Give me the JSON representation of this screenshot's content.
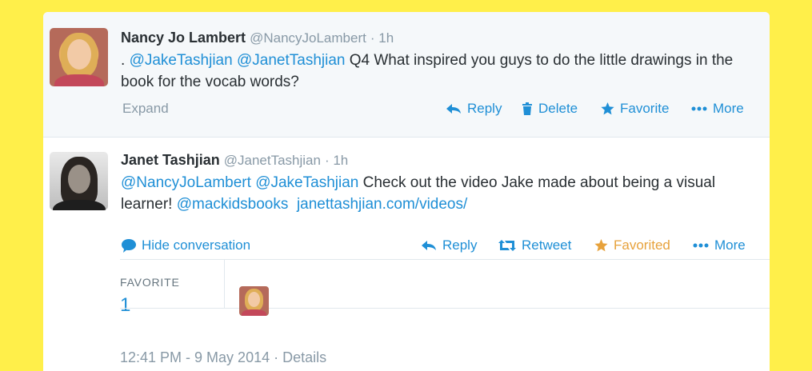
{
  "colors": {
    "background": "#ffef4a",
    "link": "#1f8fd6",
    "muted": "#8899a6",
    "favorited": "#e7a23c"
  },
  "tweet1": {
    "fullname": "Nancy Jo Lambert",
    "screenname": "@NancyJoLambert",
    "time": "· 1h",
    "text_prefix": ". ",
    "mention1": "@JakeTashjian",
    "mention2": "@JanetTashjian",
    "text_body": " Q4 What inspired you guys to do the little drawings in the book for the vocab words?",
    "expand": "Expand",
    "actions": {
      "reply": "Reply",
      "delete": "Delete",
      "favorite": "Favorite",
      "more": "More"
    },
    "icons": [
      "reply-icon",
      "trash-icon",
      "star-icon",
      "more-dots-icon"
    ]
  },
  "tweet2": {
    "fullname": "Janet Tashjian",
    "screenname": "@JanetTashjian",
    "time": "· 1h",
    "mention1": "@NancyJoLambert",
    "mention2": "@JakeTashjian",
    "text_body": " Check out the video Jake made about being a visual learner! ",
    "mention3": "@mackidsbooks",
    "link": "janettashjian.com/videos/",
    "hide_conversation": "Hide conversation",
    "actions": {
      "reply": "Reply",
      "retweet": "Retweet",
      "favorited": "Favorited",
      "more": "More"
    },
    "icons": [
      "speech-bubble-icon",
      "reply-icon",
      "retweet-icon",
      "star-icon",
      "more-dots-icon"
    ],
    "stats": {
      "favorite_label": "FAVORITE",
      "favorite_count": "1"
    },
    "footer": "12:41 PM - 9 May 2014 · Details"
  }
}
